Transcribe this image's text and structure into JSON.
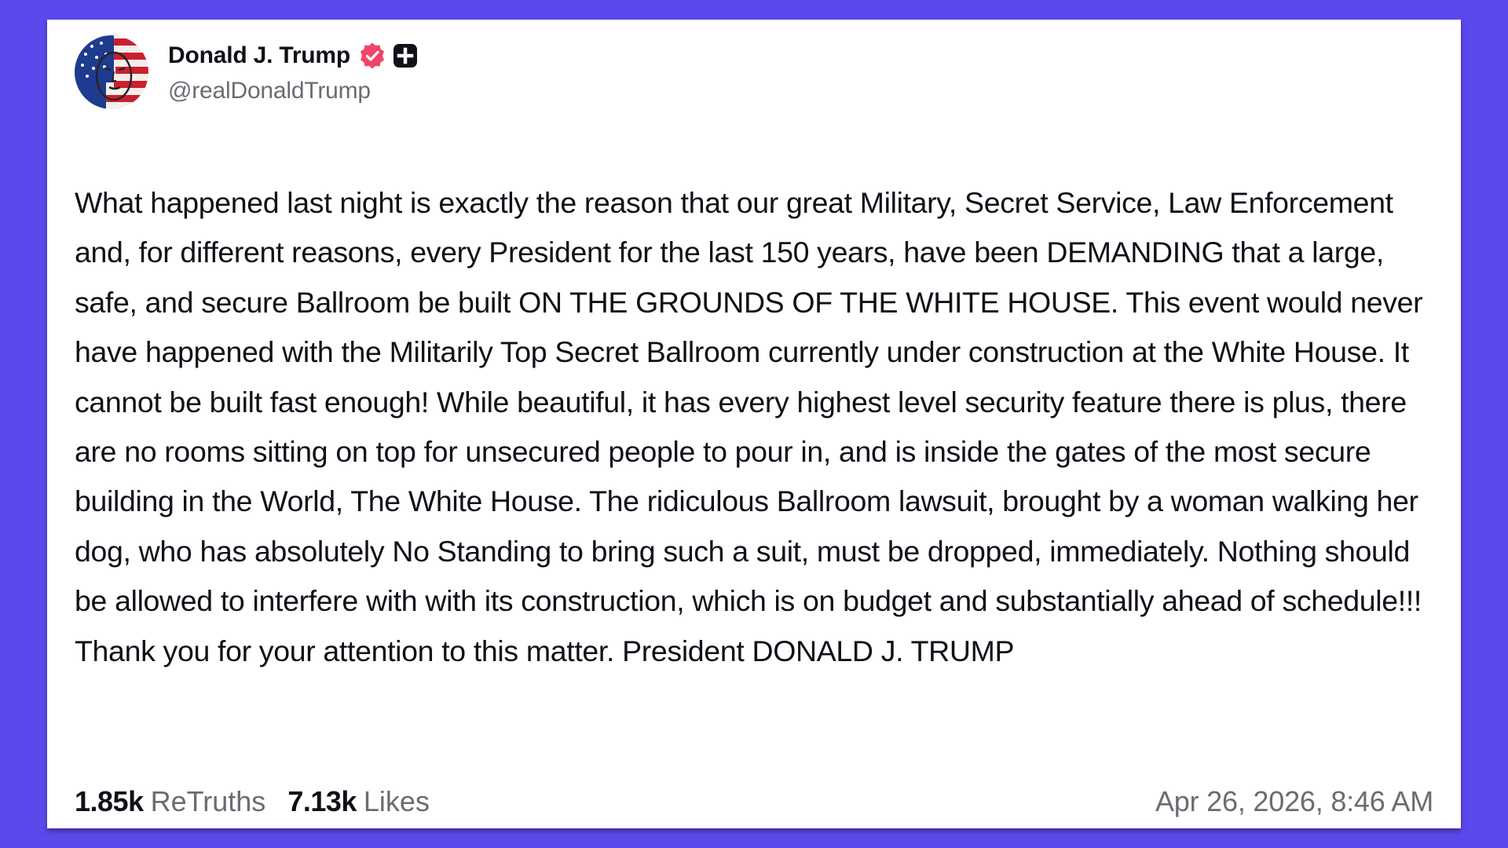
{
  "colors": {
    "background": "#5b49ec",
    "card": "#ffffff",
    "verified_badge": "#f04468",
    "text_primary": "#101018",
    "text_secondary": "#6b6b73"
  },
  "author": {
    "display_name": "Donald J. Trump",
    "handle": "@realDonaldTrump",
    "avatar_icon": "flag-face-avatar",
    "verified_icon": "verified-badge-icon",
    "plus_icon": "plus-badge-icon"
  },
  "post": {
    "text": "What happened last night is exactly the reason that our great Military, Secret Service, Law Enforcement and, for different reasons, every President for the last 150 years, have been DEMANDING that a large, safe, and secure Ballroom be built ON THE GROUNDS OF THE WHITE HOUSE. This event would never have happened with the Militarily Top Secret Ballroom currently under construction at the White House. It cannot be built fast enough! While beautiful, it has every highest level security feature there is plus, there are no rooms sitting on top for unsecured people to pour in, and is inside the gates of the most secure building in the World, The White House. The ridiculous Ballroom lawsuit, brought by a woman walking her dog, who has absolutely No Standing to bring such a suit, must be dropped, immediately. Nothing should be allowed to interfere with with its construction, which is on budget and substantially ahead of schedule!!! Thank you for your attention to this matter. President DONALD J. TRUMP"
  },
  "stats": {
    "retruths_count": "1.85k",
    "retruths_label": "ReTruths",
    "likes_count": "7.13k",
    "likes_label": "Likes"
  },
  "timestamp": "Apr 26, 2026, 8:46 AM"
}
